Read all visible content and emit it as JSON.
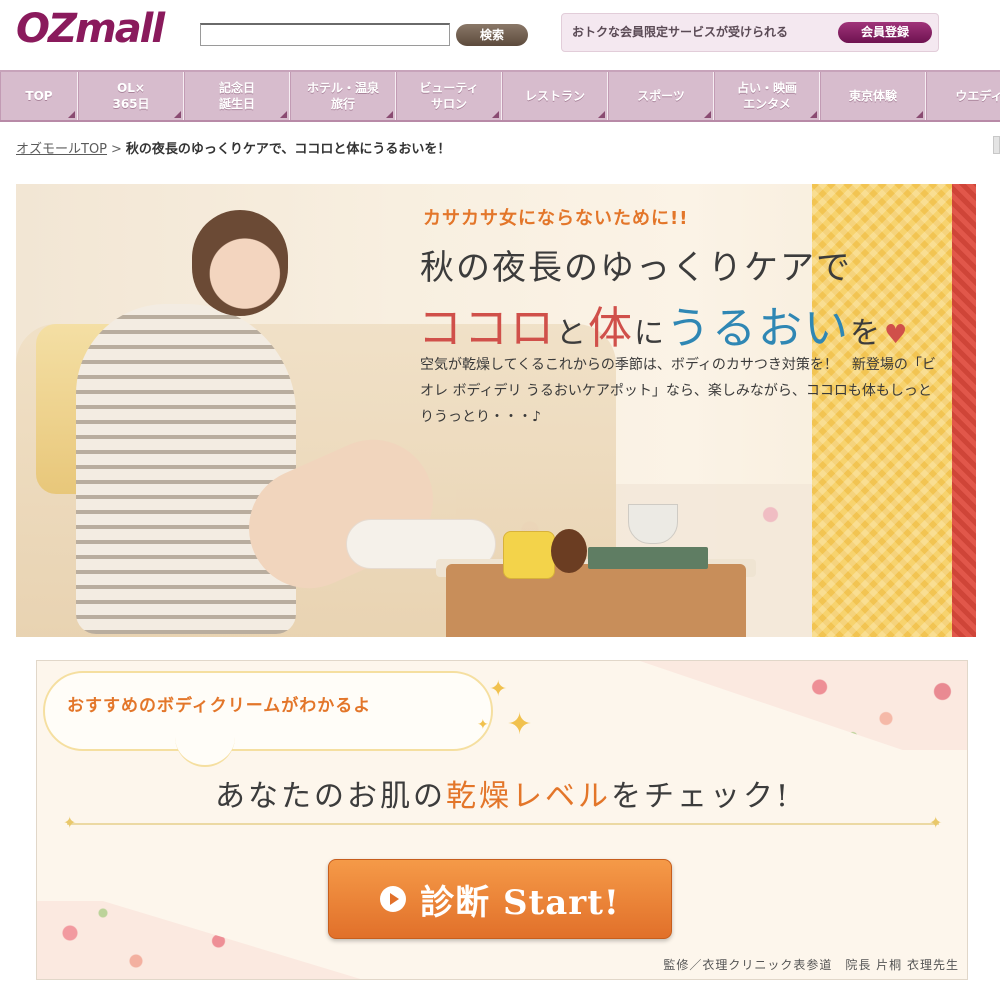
{
  "header": {
    "logo_text": "OZmall",
    "search_placeholder": "",
    "search_button": "検索",
    "member_text": "おトクな会員限定サービスが受けられる",
    "member_button": "会員登録"
  },
  "nav": {
    "items": [
      {
        "label": "TOP"
      },
      {
        "label": "OL×\n365日"
      },
      {
        "label": "記念日\n誕生日"
      },
      {
        "label": "ホテル・温泉\n旅行"
      },
      {
        "label": "ビューティ\nサロン"
      },
      {
        "label": "レストラン"
      },
      {
        "label": "スポーツ"
      },
      {
        "label": "占い・映画\nエンタメ"
      },
      {
        "label": "東京体験"
      },
      {
        "label": "ウエディ"
      }
    ]
  },
  "breadcrumb": {
    "home": "オズモールTOP",
    "separator": ">",
    "current": "秋の夜長のゆっくりケアで、ココロと体にうるおいを！"
  },
  "hero": {
    "tagline": "カサカサ女にならないために!!",
    "title_line1": "秋の夜長のゆっくりケアで",
    "title_kokoro": "ココロ",
    "title_to": "と",
    "title_karada": "体",
    "title_ni": "に",
    "title_uruoi": "うるおい",
    "title_wo": "を",
    "body": "空気が乾燥してくるこれからの季節は、ボディのカサつき対策を！　新登場の「ビオレ ボディデリ うるおいケアポット」なら、楽しみながら、ココロも体もしっとりうっとり・・・♪"
  },
  "check": {
    "bubble": "おすすめのボディクリームがわかるよ",
    "heading_pre": "あなたのお肌の",
    "heading_hl": "乾燥レベル",
    "heading_post": "をチェック!",
    "start_button": "診断 Start!",
    "supervisor": "監修／衣理クリニック表参道　院長 片桐 衣理先生"
  },
  "colors": {
    "brand": "#8a1a5c",
    "nav_bg": "#d7bccd",
    "accent_orange": "#e3762a",
    "accent_red": "#d0504a",
    "accent_blue": "#2f87b4"
  }
}
